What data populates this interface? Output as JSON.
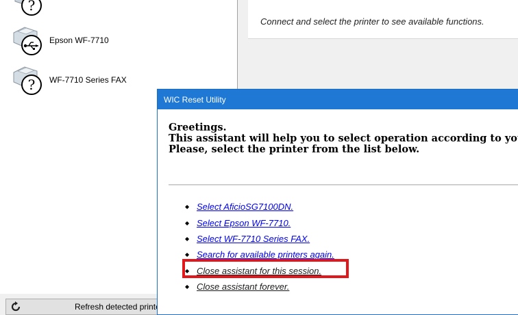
{
  "printer_list": {
    "items": [
      {
        "label": "",
        "icon": "help-icon"
      },
      {
        "label": "Epson WF-7710",
        "icon": "usb-printer-icon"
      },
      {
        "label": "WF-7710 Series FAX",
        "icon": "help-printer-icon"
      }
    ]
  },
  "status_panel": {
    "message": "Connect and select the printer to see available functions."
  },
  "refresh_bar": {
    "label": "Refresh detected printers list",
    "icon": "refresh-icon"
  },
  "dialog": {
    "title": "WIC Reset Utility",
    "greeting_lines": [
      "Greetings.",
      "This assistant will help you to select operation according to you",
      "Please, select the printer from the list below."
    ],
    "options": [
      {
        "label": "Select AficioSG7100DN."
      },
      {
        "label": "Select Epson WF-7710."
      },
      {
        "label": "Select WF-7710 Series FAX."
      },
      {
        "label": "Search for available printers again."
      },
      {
        "label": "Close assistant for this session.",
        "highlighted": true
      },
      {
        "label": "Close assistant forever."
      }
    ],
    "highlight_color": "#e0181c",
    "titlebar_color": "#1e78d4",
    "link_color": "#0000ee"
  }
}
